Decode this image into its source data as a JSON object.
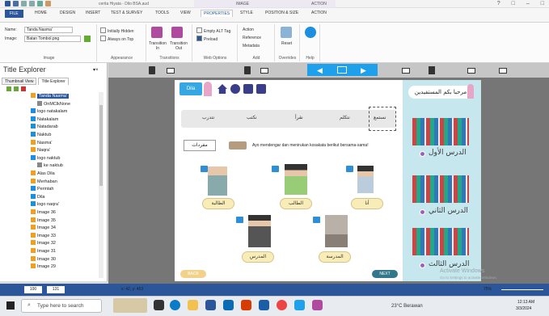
{
  "titlebar": {
    "doc_title": "cerita Hiyata - Dilo BSA.aud",
    "ctx_image": "IMAGE",
    "ctx_action": "ACTION"
  },
  "tabs": [
    "FILE",
    "HOME",
    "DESIGN",
    "INSERT",
    "TEST & SURVEY",
    "TOOLS",
    "VIEW",
    "PROPERTIES",
    "STYLE",
    "POSITION & SIZE",
    "ACTION"
  ],
  "ribbon": {
    "name_label": "Name:",
    "name_value": "Tanda Nasma'",
    "image_label": "Image:",
    "image_value": "Batan Tombol.png",
    "g_image": "Image",
    "initially_hidden": "Initially Hidden",
    "always_on_top": "Always on Top",
    "g_appearance": "Appearance",
    "transition_in": "Transition In",
    "transition_out": "Transition Out",
    "g_transitions": "Transitions",
    "empty_alt": "Empty ALT Tag",
    "preload": "Preload",
    "g_web": "Web Options",
    "action": "Action",
    "reference": "Reference",
    "metadata": "Metadata",
    "g_add": "Add",
    "reset": "Reset",
    "g_overrides": "Overrides",
    "g_help": "Help"
  },
  "explorer": {
    "title": "Title Explorer",
    "tab1": "Thumbnail View",
    "tab2": "Title Explorer",
    "items": [
      "Tanda Nasma'",
      "OnMClkNone",
      "logo natakalam",
      "Natakalam",
      "Natadarab",
      "Naktub",
      "Nasma'",
      "Naqra'",
      "logo naktub",
      "ke naktub",
      "Alas Dila",
      "Merhaban",
      "Perintah",
      "Dila",
      "logo naqra'",
      "Image 36",
      "Image 35",
      "Image 34",
      "Image 33",
      "Image 32",
      "Image 31",
      "Image 30",
      "Image 29"
    ]
  },
  "slide": {
    "logo": "Dila",
    "modes": [
      "نستمع",
      "نتكلم",
      "نقرأ",
      "نكتب",
      "نتدرب"
    ],
    "title_card": "مفردات",
    "instruction": "Ayo mendengar dan menirukan kosakata berikut bersama-sama!",
    "labels": [
      "الطالبة",
      "الطالب",
      "أنا",
      "المدرس",
      "المدرسة"
    ],
    "back": "BACK",
    "next": "NEXT"
  },
  "side": {
    "title": "مرحبا بكم المستفيدين",
    "lessons": [
      "الدرس الأول",
      "الدرس الثاني",
      "الدرس الثالث"
    ]
  },
  "watermark": {
    "line1": "Activate Windows",
    "line2": "Go to Settings to activate Windows."
  },
  "status": {
    "zoom_a": "100",
    "zoom_b": "131",
    "coords": "x: 42, y: 453",
    "zoom_pct": "75%"
  },
  "taskbar": {
    "search": "Type here to search",
    "weather": "23°C Berawan",
    "time": "12:13 AM",
    "date": "3/3/2024"
  },
  "colors": {
    "accent": "#2b579a",
    "cyan": "#1ea0ea",
    "side": "#c7e7ef"
  }
}
